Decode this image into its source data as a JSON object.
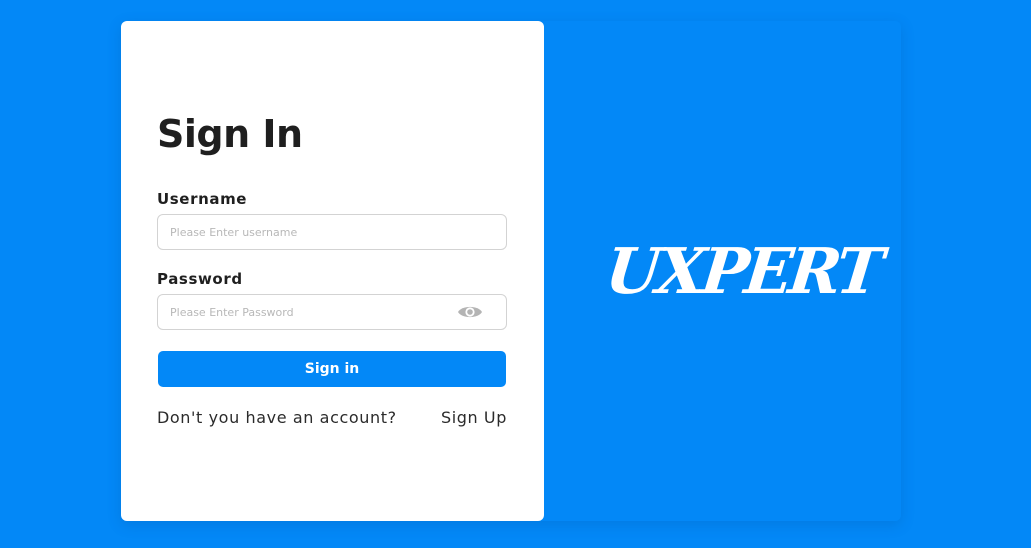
{
  "signin": {
    "title": "Sign In",
    "username_label": "Username",
    "username_placeholder": "Please Enter username",
    "username_value": "",
    "password_label": "Password",
    "password_placeholder": "Please Enter Password",
    "password_value": "",
    "submit_label": "Sign in",
    "no_account_text": "Don't you have an account?",
    "signup_label": "Sign Up"
  },
  "brand": {
    "logo_text": "UXPERT"
  },
  "icons": {
    "password_toggle": "eye-icon"
  },
  "colors": {
    "accent": "#0388f7",
    "card_background": "#ffffff",
    "text": "#1f1f1f",
    "input_border": "#d3d3d3",
    "placeholder": "#b8b8b8",
    "icon": "#b4b4b4"
  }
}
